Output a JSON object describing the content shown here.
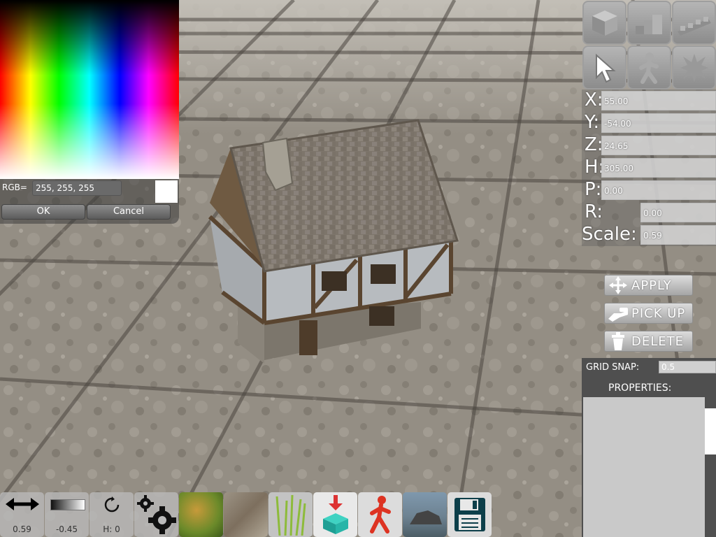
{
  "color_picker": {
    "rgb_label": "RGB=",
    "rgb_value": "255, 255, 255",
    "ok_label": "OK",
    "cancel_label": "Cancel",
    "selected_color": "#ffffff"
  },
  "toolbar_top": {
    "buttons": [
      {
        "icon": "cube-icon"
      },
      {
        "icon": "stair-blocks-icon"
      },
      {
        "icon": "wall-blocks-icon"
      },
      {
        "icon": "cursor-arrow-icon"
      },
      {
        "icon": "walking-person-icon"
      },
      {
        "icon": "explosion-icon"
      }
    ]
  },
  "transform": {
    "x_label": "X:",
    "x_value": "55.00",
    "y_label": "Y:",
    "y_value": "-54.00",
    "z_label": "Z:",
    "z_value": "24.65",
    "h_label": "H:",
    "h_value": "305.00",
    "p_label": "P:",
    "p_value": "0.00",
    "r_label": "R:",
    "r_value": "0.00",
    "scale_label": "Scale:",
    "scale_value": "0.59"
  },
  "actions": {
    "apply_label": "APPLY",
    "pickup_label": "PICK UP",
    "delete_label": "DELETE"
  },
  "grid_snap": {
    "label": "GRID SNAP:",
    "value": "0.5"
  },
  "properties": {
    "label": "PROPERTIES:"
  },
  "bottom_toolbar": {
    "scale_value": "0.59",
    "brightness_value": "-0.45",
    "rotation_value": "H: 0",
    "items": [
      {
        "icon": "double-arrow-icon"
      },
      {
        "icon": "gradient-icon"
      },
      {
        "icon": "rotate-icon"
      },
      {
        "icon": "gears-icon"
      },
      {
        "icon": "grass-texture-icon"
      },
      {
        "icon": "rock-texture-icon"
      },
      {
        "icon": "reeds-icon"
      },
      {
        "icon": "drop-object-icon"
      },
      {
        "icon": "walking-person-icon"
      },
      {
        "icon": "terrain-icon"
      },
      {
        "icon": "save-floppy-icon"
      }
    ]
  }
}
